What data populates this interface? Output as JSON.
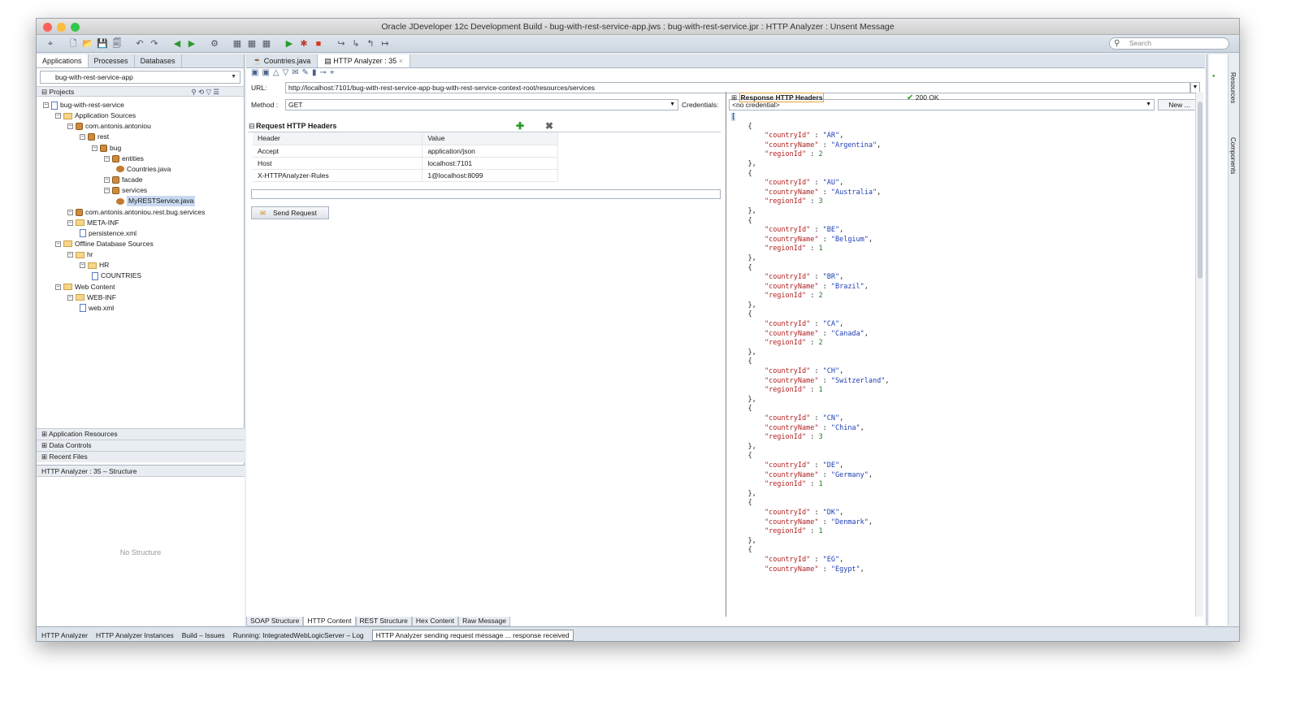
{
  "window": {
    "title": "Oracle JDeveloper 12c Development Build - bug-with-rest-service-app.jws : bug-with-rest-service.jpr : HTTP Analyzer : Unsent Message"
  },
  "toolbar": {
    "search_placeholder": "Search"
  },
  "left_tabs": [
    "Applications",
    "Processes",
    "Databases"
  ],
  "app_selector": "bug-with-rest-service-app",
  "projects_label": "Projects",
  "tree": [
    {
      "label": "bug-with-rest-service",
      "depth": 0,
      "icon": "project"
    },
    {
      "label": "Application Sources",
      "depth": 1,
      "icon": "folder"
    },
    {
      "label": "com.antonis.antoniou",
      "depth": 2,
      "icon": "package"
    },
    {
      "label": "rest",
      "depth": 3,
      "icon": "package"
    },
    {
      "label": "bug",
      "depth": 4,
      "icon": "package"
    },
    {
      "label": "entities",
      "depth": 5,
      "icon": "package"
    },
    {
      "label": "Countries.java",
      "depth": 6,
      "icon": "java"
    },
    {
      "label": "facade",
      "depth": 5,
      "icon": "package"
    },
    {
      "label": "services",
      "depth": 5,
      "icon": "package"
    },
    {
      "label": "MyRESTService.java",
      "depth": 6,
      "icon": "service",
      "selected": true
    },
    {
      "label": "com.antonis.antoniou.rest.bug.services",
      "depth": 2,
      "icon": "package"
    },
    {
      "label": "META-INF",
      "depth": 2,
      "icon": "folder"
    },
    {
      "label": "persistence.xml",
      "depth": 3,
      "icon": "file"
    },
    {
      "label": "Offline Database Sources",
      "depth": 1,
      "icon": "folder"
    },
    {
      "label": "hr",
      "depth": 2,
      "icon": "folder"
    },
    {
      "label": "HR",
      "depth": 3,
      "icon": "folder"
    },
    {
      "label": "COUNTRIES",
      "depth": 4,
      "icon": "table"
    },
    {
      "label": "Web Content",
      "depth": 1,
      "icon": "folder"
    },
    {
      "label": "WEB-INF",
      "depth": 2,
      "icon": "folder"
    },
    {
      "label": "web.xml",
      "depth": 3,
      "icon": "file"
    }
  ],
  "accordions": [
    "Application Resources",
    "Data Controls",
    "Recent Files"
  ],
  "structure": {
    "title": "HTTP Analyzer : 35 – Structure",
    "empty": "No Structure"
  },
  "doc_tabs": [
    "Countries.java",
    "HTTP Analyzer : 35"
  ],
  "request": {
    "url_label": "URL:",
    "url": "http://localhost:7101/bug-with-rest-service-app-bug-with-rest-service-context-root/resources/services",
    "method_label": "Method :",
    "method": "GET",
    "credentials_label": "Credentials:",
    "credentials": "<no credential>",
    "new_button": "New ...",
    "headers_title": "Request HTTP Headers",
    "columns": [
      "Header",
      "Value"
    ],
    "headers": [
      {
        "name": "Accept",
        "value": "application/json"
      },
      {
        "name": "Host",
        "value": "localhost:7101"
      },
      {
        "name": "X-HTTPAnalyzer-Rules",
        "value": "1@localhost:8099"
      }
    ],
    "send_button": "Send Request"
  },
  "response": {
    "headers_title": "Response HTTP Headers",
    "status": "200 OK",
    "countries": [
      {
        "countryId": "AR",
        "countryName": "Argentina",
        "regionId": 2
      },
      {
        "countryId": "AU",
        "countryName": "Australia",
        "regionId": 3
      },
      {
        "countryId": "BE",
        "countryName": "Belgium",
        "regionId": 1
      },
      {
        "countryId": "BR",
        "countryName": "Brazil",
        "regionId": 2
      },
      {
        "countryId": "CA",
        "countryName": "Canada",
        "regionId": 2
      },
      {
        "countryId": "CH",
        "countryName": "Switzerland",
        "regionId": 1
      },
      {
        "countryId": "CN",
        "countryName": "China",
        "regionId": 3
      },
      {
        "countryId": "DE",
        "countryName": "Germany",
        "regionId": 1
      },
      {
        "countryId": "DK",
        "countryName": "Denmark",
        "regionId": 1
      },
      {
        "countryId": "EG",
        "countryName": "Egypt",
        "regionId": null
      }
    ]
  },
  "bottom_tabs": [
    "SOAP Structure",
    "HTTP Content",
    "REST Structure",
    "Hex Content",
    "Raw Message"
  ],
  "right_tabs": [
    "Resources",
    "Components"
  ],
  "status_items": [
    "HTTP Analyzer",
    "HTTP Analyzer Instances",
    "Build – Issues",
    "Running: IntegratedWebLogicServer – Log"
  ],
  "status_message": "HTTP Analyzer sending request message ... response received",
  "colors": {
    "accent": "#c9d9ef",
    "json_key": "#b22222",
    "json_value": "#1f3fb3",
    "ok_green": "#1f7a1f"
  }
}
